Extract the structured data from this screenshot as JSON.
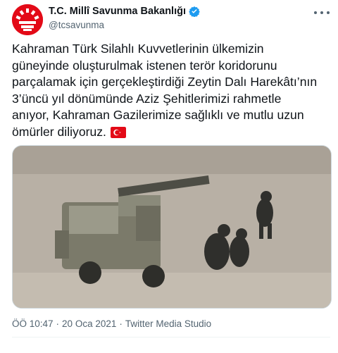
{
  "account": {
    "display_name": "T.C. Millî Savunma Bakanlığı",
    "handle": "@tcsavunma",
    "verified": true,
    "avatar_icon": "turkish-emblem-avatar"
  },
  "tweet": {
    "text": "Kahraman Türk Silahlı Kuvvetlerinin ülkemizin\ngüneyinde oluşturulmak istenen terör koridorunu\nparçalamak için gerçekleştirdiği Zeytin Dalı Harekâtı’nın\n3’üncü yıl dönümünde Aziz Şehitlerimizi rahmetle\nanıyor, Kahraman Gazilerimize sağlıklı ve mutlu uzun\nömürler diliyoruz.",
    "emoji": "turkey-flag-icon"
  },
  "meta": {
    "time": "ÖÖ 10:47",
    "sep1": "·",
    "date": "20 Oca 2021",
    "sep2": "·",
    "source": "Twitter Media Studio"
  },
  "colors": {
    "accent": "#1d9bf0",
    "flag_red": "#e30a17",
    "secondary_text": "#536471"
  }
}
